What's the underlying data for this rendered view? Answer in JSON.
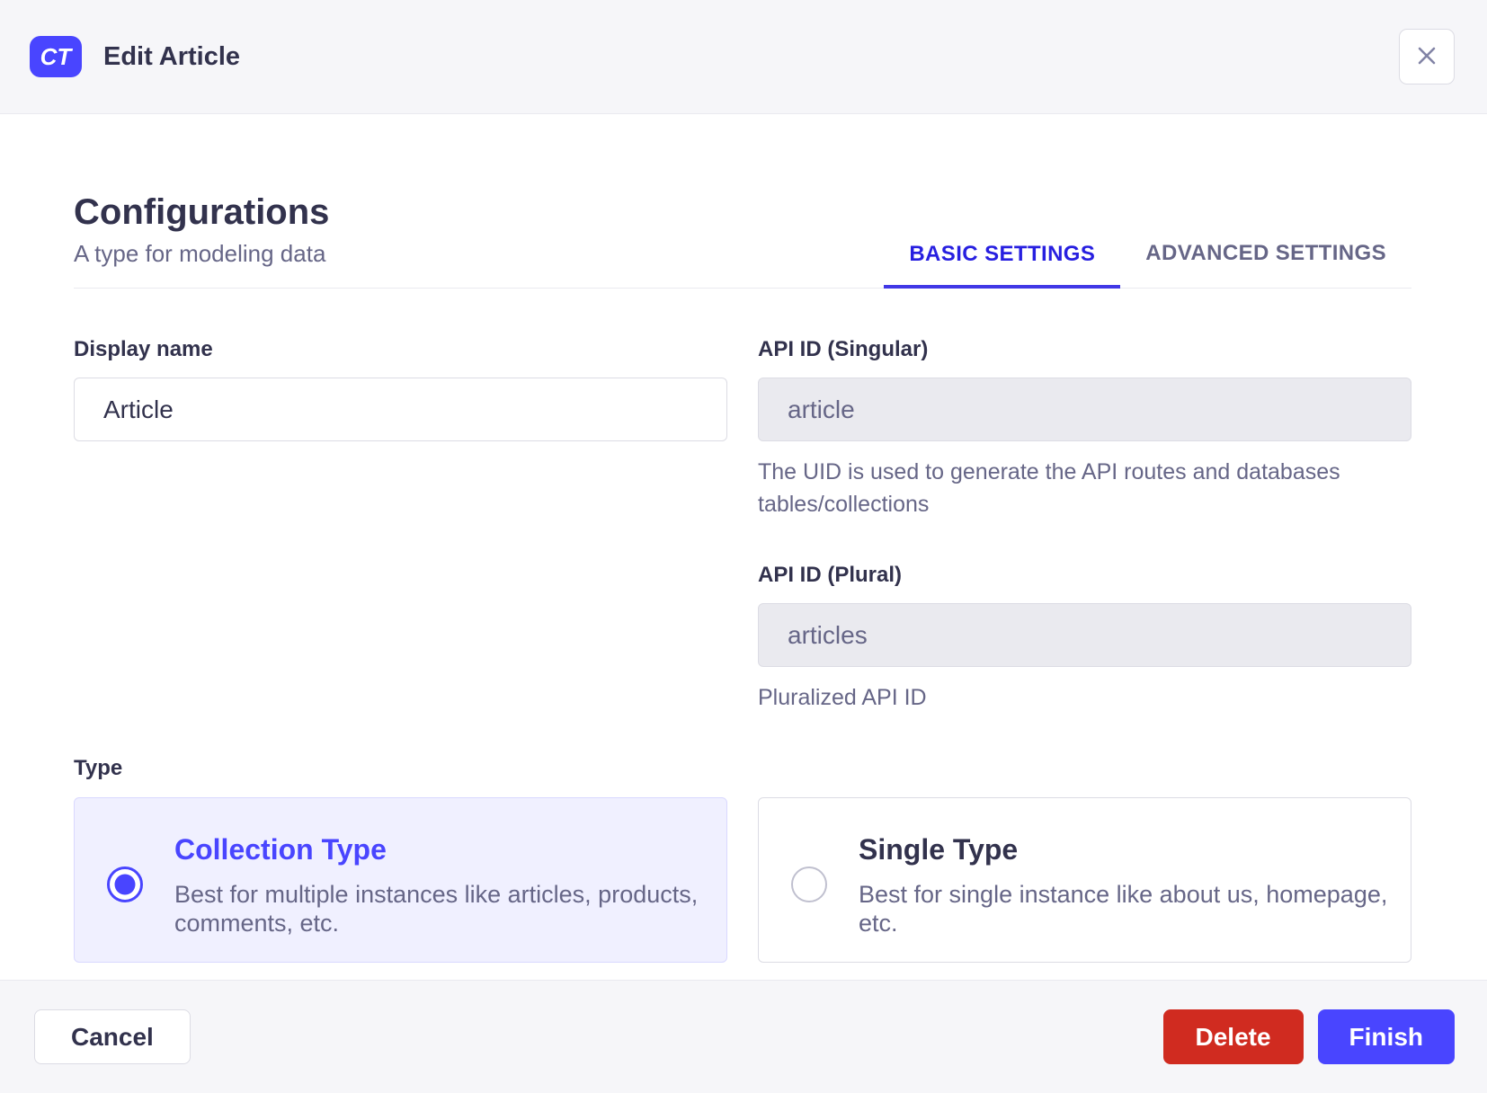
{
  "header": {
    "badge": "CT",
    "title": "Edit Article"
  },
  "section": {
    "title": "Configurations",
    "subtitle": "A type for modeling data"
  },
  "tabs": {
    "basic": "BASIC SETTINGS",
    "advanced": "ADVANCED SETTINGS",
    "active": "basic"
  },
  "fields": {
    "display_name": {
      "label": "Display name",
      "value": "Article"
    },
    "api_id_singular": {
      "label": "API ID (Singular)",
      "value": "article",
      "disabled": true,
      "hint_lines": {
        "line1": "The UID is used to generate the API routes and databases",
        "line2": "tables/collections"
      }
    },
    "api_id_plural": {
      "label": "API ID (Plural)",
      "value": "articles",
      "disabled": true,
      "hint": "Pluralized API ID"
    }
  },
  "type_section": {
    "label": "Type",
    "options": [
      {
        "title": "Collection Type",
        "desc_line1": "Best for multiple instances like articles, products,",
        "desc_line2": "comments, etc.",
        "selected": true
      },
      {
        "title": "Single Type",
        "desc_line1": "Best for single instance like about us, homepage,",
        "desc_line2": "etc.",
        "selected": false
      }
    ]
  },
  "footer": {
    "cancel": "Cancel",
    "delete": "Delete",
    "finish": "Finish"
  },
  "colors": {
    "primary": "#4945ff",
    "primary_text": "#271fe0",
    "danger": "#d02b20",
    "neutral_bg": "#f6f6f9",
    "border": "#dcdce4",
    "text_dark": "#32324d",
    "text_gray": "#666687",
    "selected_card_bg": "#f0f0ff"
  }
}
